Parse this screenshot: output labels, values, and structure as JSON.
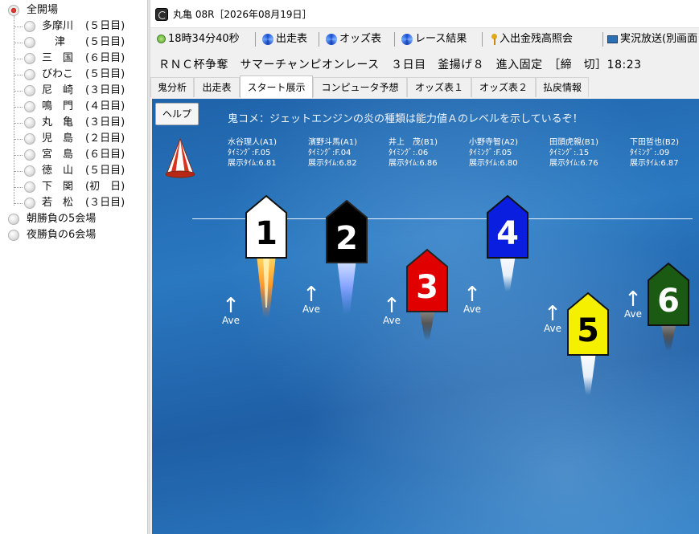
{
  "sidebar": {
    "root": "全開場",
    "venues": [
      {
        "name": "多摩川",
        "day": "(５日目)"
      },
      {
        "name": "津",
        "day": "(５日目)"
      },
      {
        "name": "三　国",
        "day": "(６日目)"
      },
      {
        "name": "びわこ",
        "day": "(５日目)"
      },
      {
        "name": "尼　崎",
        "day": "(３日目)"
      },
      {
        "name": "鳴　門",
        "day": "(４日目)"
      },
      {
        "name": "丸　亀",
        "day": "(３日目)"
      },
      {
        "name": "児　島",
        "day": "(２日目)"
      },
      {
        "name": "宮　島",
        "day": "(６日目)"
      },
      {
        "name": "徳　山",
        "day": "(５日目)"
      },
      {
        "name": "下　関",
        "day": "(初　日)"
      },
      {
        "name": "若　松",
        "day": "(３日目)"
      }
    ],
    "groups": [
      "朝勝負の5会場",
      "夜勝負の6会場"
    ]
  },
  "window": {
    "title": "丸亀 08R［2026年08月19日］"
  },
  "toolbar": {
    "clock": "18時34分40秒",
    "entries": "出走表",
    "odds": "オッズ表",
    "results": "レース結果",
    "balance": "入出金残高照会",
    "live": "実況放送(別画面"
  },
  "race_header": "ＲＮＣ杯争奪　サマーチャンピオンレース　３日目　釜揚げ８　進入固定　［締　切］18:23",
  "tabs": [
    "鬼分析",
    "出走表",
    "スタート展示",
    "コンピュータ予想",
    "オッズ表１",
    "オッズ表２",
    "払戻情報"
  ],
  "active_tab": "スタート展示",
  "panel": {
    "help": "ヘルプ",
    "comment": "鬼コメ：ジェットエンジンの炎の種類は能力値Ａのレベルを示しているぞ！",
    "ave_label": "Ave",
    "racers": [
      {
        "name": "水谷理人(A1)",
        "timing": "ﾀｲﾐﾝｸﾞ:F.05",
        "tenji": "展示ﾀｲﾑ:6.81"
      },
      {
        "name": "濱野斗馬(A1)",
        "timing": "ﾀｲﾐﾝｸﾞ:F.04",
        "tenji": "展示ﾀｲﾑ:6.82"
      },
      {
        "name": "井上　茂(B1)",
        "timing": "ﾀｲﾐﾝｸﾞ:.06",
        "tenji": "展示ﾀｲﾑ:6.86"
      },
      {
        "name": "小野寺智(A2)",
        "timing": "ﾀｲﾐﾝｸﾞ:F.05",
        "tenji": "展示ﾀｲﾑ:6.80"
      },
      {
        "name": "田頭虎親(B1)",
        "timing": "ﾀｲﾐﾝｸﾞ:.15",
        "tenji": "展示ﾀｲﾑ:6.76"
      },
      {
        "name": "下田哲也(B2)",
        "timing": "ﾀｲﾐﾝｸﾞ:.09",
        "tenji": "展示ﾀｲﾑ:6.87"
      }
    ],
    "boats": [
      {
        "number": "1",
        "fill": "#ffffff",
        "text": "#000000",
        "flame": "orange"
      },
      {
        "number": "2",
        "fill": "#000000",
        "text": "#ffffff",
        "flame": "blue"
      },
      {
        "number": "3",
        "fill": "#e00000",
        "text": "#ffffff",
        "flame": "gray"
      },
      {
        "number": "4",
        "fill": "#0a1ee0",
        "text": "#ffffff",
        "flame": "white"
      },
      {
        "number": "5",
        "fill": "#f5f000",
        "text": "#000000",
        "flame": "white"
      },
      {
        "number": "6",
        "fill": "#1a5a12",
        "text": "#ffffff",
        "flame": "gray"
      }
    ]
  }
}
